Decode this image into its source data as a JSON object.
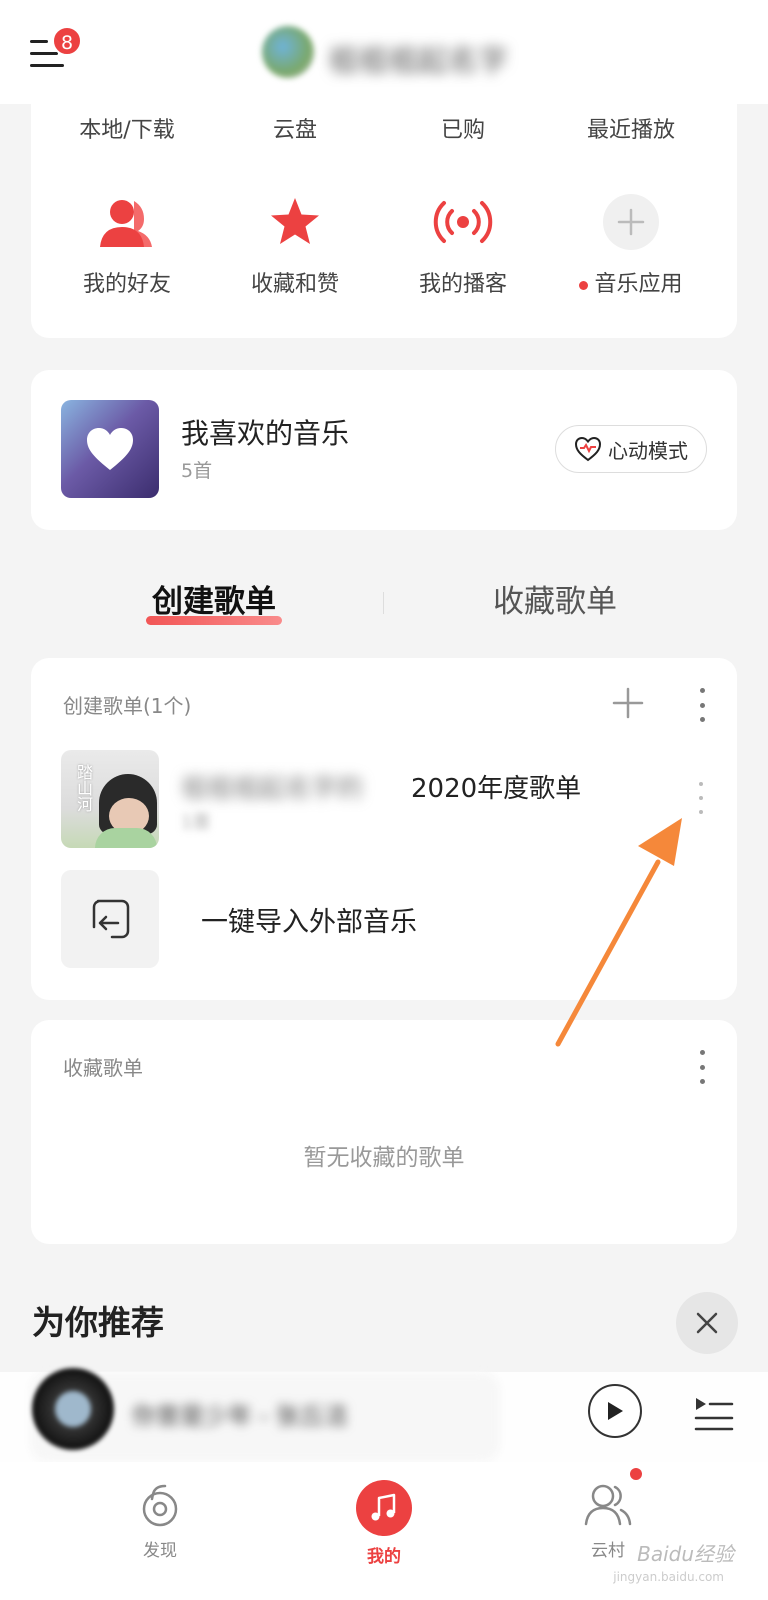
{
  "header": {
    "menu_badge": "8",
    "user_name": "祖祖祖起名字"
  },
  "quick_links": [
    "本地/下载",
    "云盘",
    "已购",
    "最近播放"
  ],
  "shortcuts": [
    {
      "label": "我的好友",
      "icon": "friends-icon"
    },
    {
      "label": "收藏和赞",
      "icon": "star-icon"
    },
    {
      "label": "我的播客",
      "icon": "podcast-icon"
    },
    {
      "label": "音乐应用",
      "icon": "plus-icon"
    }
  ],
  "favorites": {
    "title": "我喜欢的音乐",
    "count": "5首",
    "heart_mode_label": "心动模式"
  },
  "tabs": {
    "created": "创建歌单",
    "collected": "收藏歌单"
  },
  "created_section": {
    "title": "创建歌单(1个)",
    "playlist": {
      "name_prefix": "祖祖祖起名字的",
      "name": "2020年度歌单",
      "count": "1首",
      "cover_text": "踏山河"
    },
    "import_label": "一键导入外部音乐"
  },
  "collected_section": {
    "title": "收藏歌单",
    "empty_message": "暂无收藏的歌单"
  },
  "recommend": {
    "title": "为你推荐"
  },
  "mini_player": {
    "song": "你曾是少年 - 张丘洁"
  },
  "tabbar": {
    "discover": "发现",
    "mine": "我的",
    "village": "云村"
  },
  "watermark": {
    "main": "Baidu经验",
    "sub": "jingyan.baidu.com"
  },
  "colors": {
    "accent": "#ec4141",
    "annotation_arrow": "#f5883a"
  }
}
